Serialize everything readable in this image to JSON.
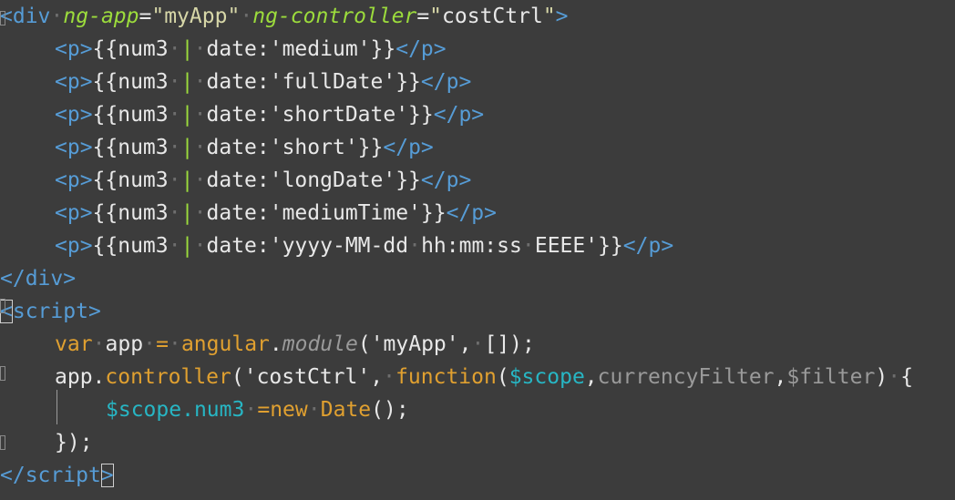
{
  "colors": {
    "background": "#3c3c3c",
    "tag": "#569cd6",
    "attribute": "#9cdc3c",
    "string": "#d7d7a8",
    "text": "#e8e8e8",
    "keyword": "#e0a030",
    "identifier": "#e8e8e8",
    "variable": "#27b6c4",
    "muted": "#9a9a9a",
    "pipe": "#9cdc3c"
  },
  "code": {
    "lines": [
      {
        "indent": 0,
        "tokens": [
          {
            "t": "<",
            "c": "tag"
          },
          {
            "t": "div",
            "c": "tag"
          },
          {
            "t": " ",
            "c": "dot"
          },
          {
            "t": "ng-app",
            "c": "attribute",
            "i": true
          },
          {
            "t": "=",
            "c": "text"
          },
          {
            "t": "\"myApp\"",
            "c": "string"
          },
          {
            "t": " ",
            "c": "dot"
          },
          {
            "t": "ng-controller",
            "c": "attribute",
            "i": true
          },
          {
            "t": "=",
            "c": "text"
          },
          {
            "t": "\"",
            "c": "string"
          },
          {
            "t": "costCtrl",
            "c": "text"
          },
          {
            "t": "\"",
            "c": "string"
          },
          {
            "t": ">",
            "c": "tag"
          }
        ]
      },
      {
        "indent": 60,
        "tokens": [
          {
            "t": "<p>",
            "c": "tag"
          },
          {
            "t": "{{num3",
            "c": "text"
          },
          {
            "t": " ",
            "c": "dot"
          },
          {
            "t": "|",
            "c": "pipe"
          },
          {
            "t": " ",
            "c": "dot"
          },
          {
            "t": "date:'medium'}}",
            "c": "text"
          },
          {
            "t": "</p>",
            "c": "tag"
          }
        ]
      },
      {
        "indent": 60,
        "tokens": [
          {
            "t": "<p>",
            "c": "tag"
          },
          {
            "t": "{{num3",
            "c": "text"
          },
          {
            "t": " ",
            "c": "dot"
          },
          {
            "t": "|",
            "c": "pipe"
          },
          {
            "t": " ",
            "c": "dot"
          },
          {
            "t": "date:'fullDate'}}",
            "c": "text"
          },
          {
            "t": "</p>",
            "c": "tag"
          }
        ]
      },
      {
        "indent": 60,
        "tokens": [
          {
            "t": "<p>",
            "c": "tag"
          },
          {
            "t": "{{num3",
            "c": "text"
          },
          {
            "t": " ",
            "c": "dot"
          },
          {
            "t": "|",
            "c": "pipe"
          },
          {
            "t": " ",
            "c": "dot"
          },
          {
            "t": "date:'shortDate'}}",
            "c": "text"
          },
          {
            "t": "</p>",
            "c": "tag"
          }
        ]
      },
      {
        "indent": 60,
        "tokens": [
          {
            "t": "<p>",
            "c": "tag"
          },
          {
            "t": "{{num3",
            "c": "text"
          },
          {
            "t": " ",
            "c": "dot"
          },
          {
            "t": "|",
            "c": "pipe"
          },
          {
            "t": " ",
            "c": "dot"
          },
          {
            "t": "date:'short'}}",
            "c": "text"
          },
          {
            "t": "</p>",
            "c": "tag"
          }
        ]
      },
      {
        "indent": 60,
        "tokens": [
          {
            "t": "<p>",
            "c": "tag"
          },
          {
            "t": "{{num3",
            "c": "text"
          },
          {
            "t": " ",
            "c": "dot"
          },
          {
            "t": "|",
            "c": "pipe"
          },
          {
            "t": " ",
            "c": "dot"
          },
          {
            "t": "date:'longDate'}}",
            "c": "text"
          },
          {
            "t": "</p>",
            "c": "tag"
          }
        ]
      },
      {
        "indent": 60,
        "tokens": [
          {
            "t": "<p>",
            "c": "tag"
          },
          {
            "t": "{{num3",
            "c": "text"
          },
          {
            "t": " ",
            "c": "dot"
          },
          {
            "t": "|",
            "c": "pipe"
          },
          {
            "t": " ",
            "c": "dot"
          },
          {
            "t": "date:'mediumTime'}}",
            "c": "text"
          },
          {
            "t": "</p>",
            "c": "tag"
          }
        ]
      },
      {
        "indent": 60,
        "tokens": [
          {
            "t": "<p>",
            "c": "tag"
          },
          {
            "t": "{{num3",
            "c": "text"
          },
          {
            "t": " ",
            "c": "dot"
          },
          {
            "t": "|",
            "c": "pipe"
          },
          {
            "t": " ",
            "c": "dot"
          },
          {
            "t": "date:'yyyy-MM-dd",
            "c": "text"
          },
          {
            "t": " ",
            "c": "dot"
          },
          {
            "t": "hh:mm:ss",
            "c": "text"
          },
          {
            "t": " ",
            "c": "dot"
          },
          {
            "t": "EEEE'}}",
            "c": "text"
          },
          {
            "t": "</p>",
            "c": "tag"
          }
        ]
      },
      {
        "indent": 0,
        "tokens": [
          {
            "t": "<",
            "c": "tag"
          },
          {
            "t": "/div>",
            "c": "tag"
          }
        ]
      },
      {
        "indent": 0,
        "tokens": [
          {
            "t": "<",
            "c": "tag",
            "box": true
          },
          {
            "t": "script>",
            "c": "tag"
          }
        ]
      },
      {
        "indent": 60,
        "tokens": [
          {
            "t": "var",
            "c": "keyword"
          },
          {
            "t": " ",
            "c": "dot"
          },
          {
            "t": "app",
            "c": "identifier"
          },
          {
            "t": " ",
            "c": "dot"
          },
          {
            "t": "=",
            "c": "keyword"
          },
          {
            "t": " ",
            "c": "dot"
          },
          {
            "t": "angular",
            "c": "keyword"
          },
          {
            "t": ".",
            "c": "text"
          },
          {
            "t": "module",
            "c": "muted",
            "i": true
          },
          {
            "t": "('myApp',",
            "c": "text"
          },
          {
            "t": " ",
            "c": "dot"
          },
          {
            "t": "[]);",
            "c": "text"
          }
        ]
      },
      {
        "indent": 60,
        "tokens": [
          {
            "t": "app",
            "c": "identifier"
          },
          {
            "t": ".",
            "c": "text"
          },
          {
            "t": "controller",
            "c": "keyword"
          },
          {
            "t": "('costCtrl',",
            "c": "text"
          },
          {
            "t": " ",
            "c": "dot"
          },
          {
            "t": "function",
            "c": "keyword"
          },
          {
            "t": "(",
            "c": "text"
          },
          {
            "t": "$scope",
            "c": "variable"
          },
          {
            "t": ",",
            "c": "text"
          },
          {
            "t": "currencyFilter",
            "c": "muted"
          },
          {
            "t": ",",
            "c": "text"
          },
          {
            "t": "$filter",
            "c": "muted"
          },
          {
            "t": ")",
            "c": "text"
          },
          {
            "t": " ",
            "c": "dot"
          },
          {
            "t": "{",
            "c": "text"
          }
        ]
      },
      {
        "indent": 116,
        "tokens": [
          {
            "t": "$scope",
            "c": "variable"
          },
          {
            "t": ".num3",
            "c": "variable"
          },
          {
            "t": " ",
            "c": "dot"
          },
          {
            "t": "=",
            "c": "keyword"
          },
          {
            "t": "new",
            "c": "keyword"
          },
          {
            "t": " ",
            "c": "dot"
          },
          {
            "t": "Date",
            "c": "keyword"
          },
          {
            "t": "();",
            "c": "text"
          }
        ]
      },
      {
        "indent": 60,
        "tokens": [
          {
            "t": "});",
            "c": "text"
          }
        ]
      },
      {
        "indent": 0,
        "tokens": [
          {
            "t": "<",
            "c": "tag"
          },
          {
            "t": "/script",
            "c": "tag"
          },
          {
            "t": ">",
            "c": "tag",
            "box": true
          }
        ]
      }
    ]
  }
}
